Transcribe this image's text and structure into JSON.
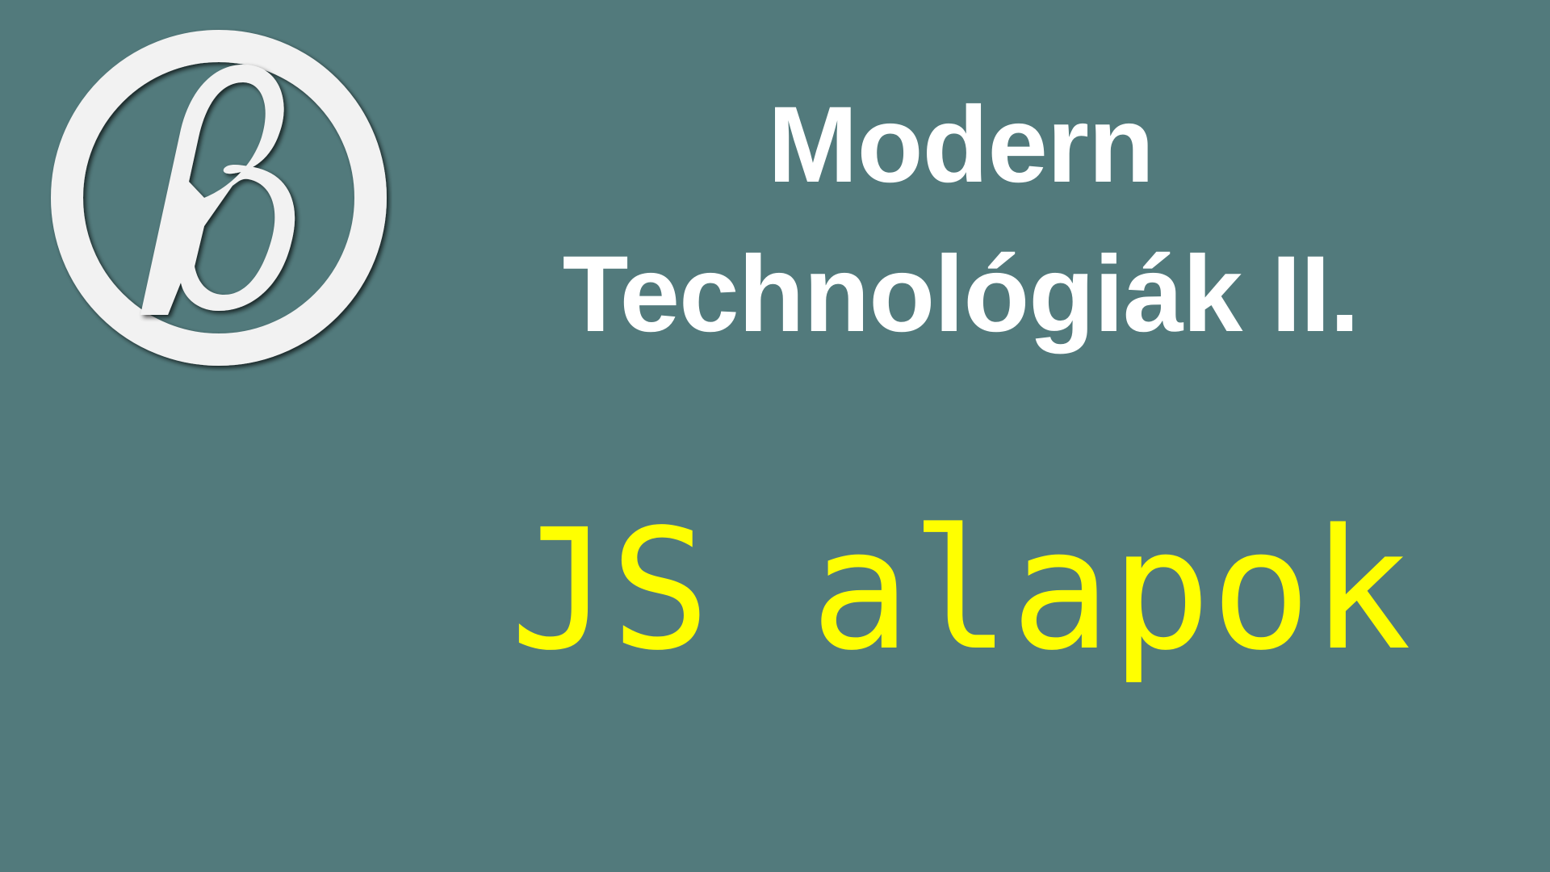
{
  "logo": {
    "icon": "beta-logo-icon",
    "glyph": "β",
    "colors": {
      "ring": "#f2f2f2",
      "shadow": "#2a3b3c"
    }
  },
  "title": {
    "line1": "Modern",
    "line2": "Technológiák II."
  },
  "subtitle": "JS alapok",
  "colors": {
    "background": "#527a7c",
    "title": "#ffffff",
    "subtitle": "#ffff00"
  }
}
